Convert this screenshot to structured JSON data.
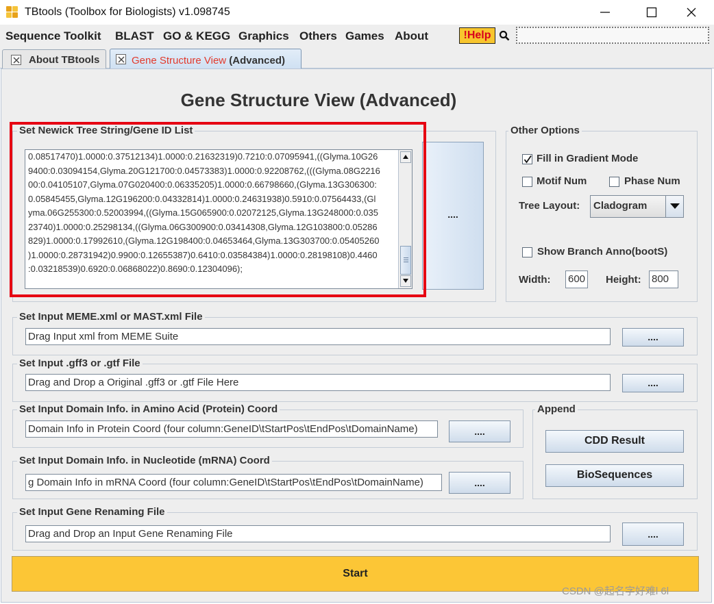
{
  "window": {
    "title": "TBtools (Toolbox for Biologists) v1.098745"
  },
  "menu": [
    "Sequence Toolkit",
    "BLAST",
    "GO & KEGG",
    "Graphics",
    "Others",
    "Games",
    "About"
  ],
  "help_label": "!Help",
  "tabs": {
    "about": "About TBtools",
    "gene_main": "Gene Structure View",
    "gene_suffix": " (Advanced)"
  },
  "page_title": "Gene Structure View (Advanced)",
  "newick": {
    "title": "Set Newick Tree String/Gene ID List",
    "lines": [
      "0.08517470)1.0000:0.37512134)1.0000:0.21632319)0.7210:0.07095941,((Glyma.10G26",
      "9400:0.03094154,Glyma.20G121700:0.04573383)1.0000:0.92208762,(((Glyma.08G2216",
      "00:0.04105107,Glyma.07G020400:0.06335205)1.0000:0.66798660,(Glyma.13G306300:",
      "0.05845455,Glyma.12G196200:0.04332814)1.0000:0.24631938)0.5910:0.07564433,(Gl",
      "yma.06G255300:0.52003994,((Glyma.15G065900:0.02072125,Glyma.13G248000:0.035",
      "23740)1.0000:0.25298134,((Glyma.06G300900:0.03414308,Glyma.12G103800:0.05286",
      "829)1.0000:0.17992610,(Glyma.12G198400:0.04653464,Glyma.13G303700:0.05405260",
      ")1.0000:0.28731942)0.9900:0.12655387)0.6410:0.03584384)1.0000:0.28198108)0.4460",
      ":0.03218539)0.6920:0.06868022)0.8690:0.12304096);"
    ],
    "browse_label": "...."
  },
  "options": {
    "title": "Other Options",
    "fill_gradient": "Fill in Gradient Mode",
    "fill_gradient_checked": true,
    "motif_num": "Motif Num",
    "phase_num": "Phase Num",
    "tree_layout_label": "Tree Layout:",
    "tree_layout_value": "Cladogram",
    "show_branch": "Show Branch Anno(bootS)",
    "width_label": "Width:",
    "width_value": "600",
    "height_label": "Height:",
    "height_value": "800"
  },
  "meme": {
    "title": "Set Input MEME.xml or MAST.xml File",
    "value": "Drag Input xml from MEME Suite",
    "browse_label": "...."
  },
  "gff": {
    "title": "Set Input .gff3 or .gtf File",
    "value": "Drag and Drop a Original .gff3 or .gtf File Here",
    "browse_label": "...."
  },
  "domain_aa": {
    "title": "Set Input Domain Info. in Amino Acid (Protein) Coord",
    "value": "Domain Info in Protein Coord (four column:GeneID\\tStartPos\\tEndPos\\tDomainName)",
    "browse_label": "...."
  },
  "domain_nt": {
    "title": "Set Input Domain Info. in Nucleotide (mRNA) Coord",
    "value": "g Domain Info in mRNA Coord (four column:GeneID\\tStartPos\\tEndPos\\tDomainName)",
    "browse_label": "...."
  },
  "append": {
    "title": "Append",
    "cdd": "CDD Result",
    "bioseq": "BioSequences"
  },
  "rename": {
    "title": "Set Input Gene Renaming File",
    "value": "Drag and Drop an Input Gene Renaming File",
    "browse_label": "...."
  },
  "start_label": "Start",
  "watermark": "CSDN @起名字好难l 6l",
  "colors": {
    "start": "#fcc636",
    "help_bg": "#f7c52e",
    "help_text": "#d8001c",
    "highlight_box": "#e60012",
    "tab_accent": "#e23a2c"
  }
}
